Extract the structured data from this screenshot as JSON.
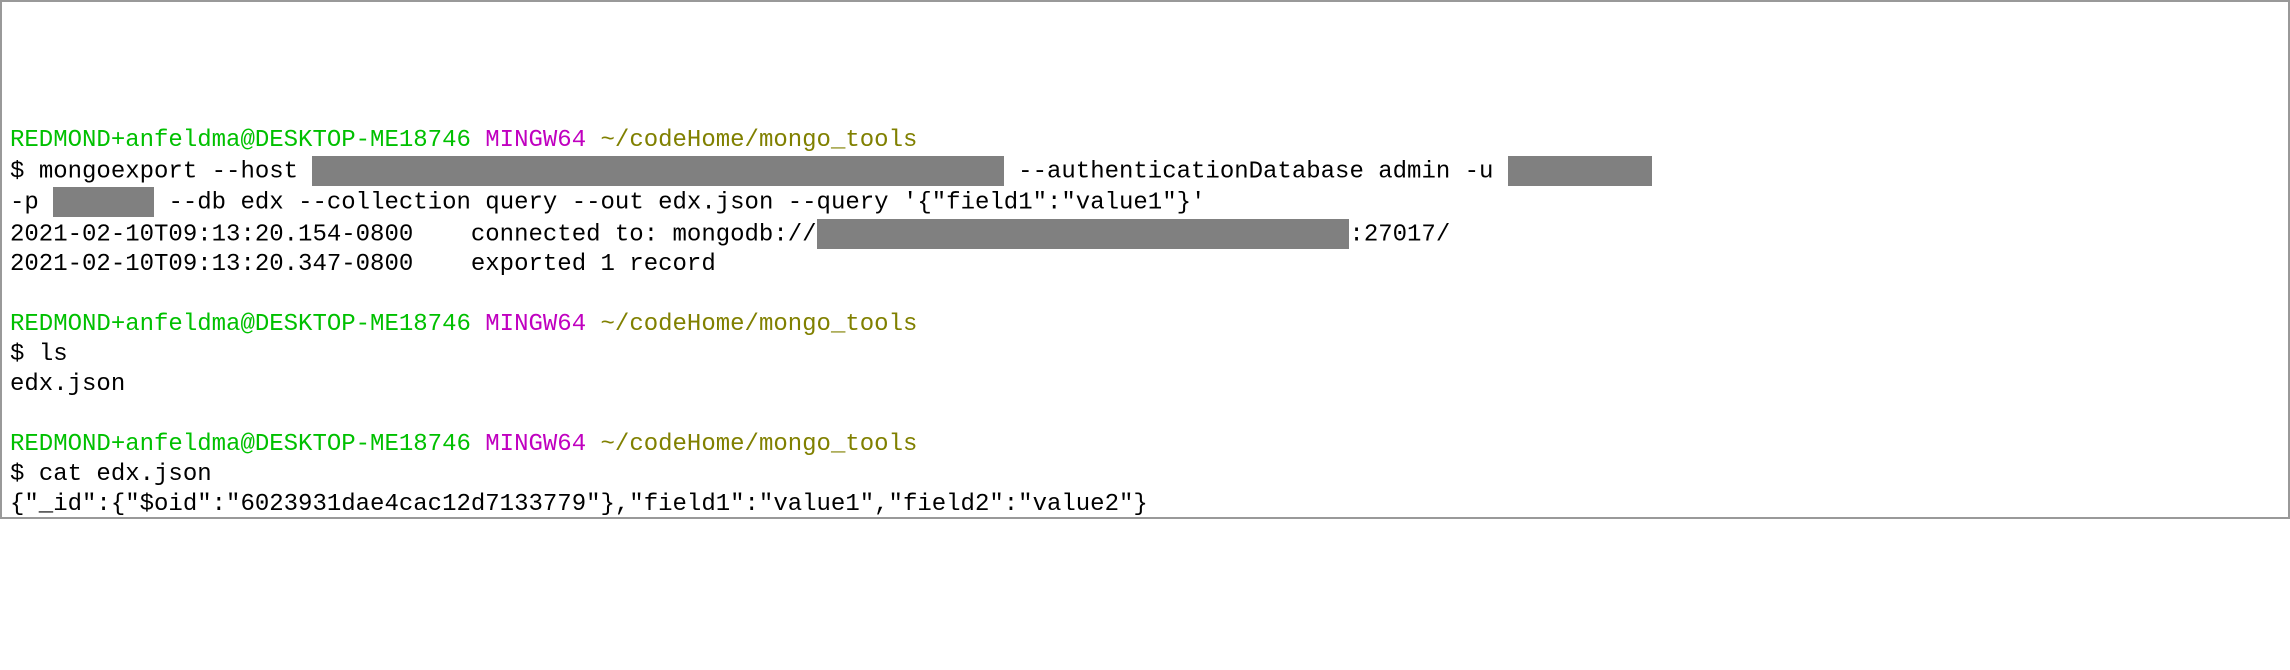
{
  "prompt": {
    "user": "REDMOND+anfeldma@DESKTOP-ME18746",
    "env": "MINGW64",
    "path": "~/codeHome/mongo_tools",
    "symbol": "$"
  },
  "block1": {
    "cmd_part1": "mongoexport --host ",
    "redacted1": "                                                ",
    "cmd_part2": " --authenticationDatabase admin -u ",
    "redacted2": "          ",
    "cmd_part3": "-p ",
    "redacted3": "       ",
    "cmd_part4": " --db edx --collection query --out edx.json --query '{\"field1\":\"value1\"}'",
    "out_line1_a": "2021-02-10T09:13:20.154-0800    connected to: mongodb://",
    "redacted4": "                                     ",
    "out_line1_b": ":27017/",
    "out_line2": "2021-02-10T09:13:20.347-0800    exported 1 record"
  },
  "block2": {
    "cmd": "ls",
    "out": "edx.json"
  },
  "block3": {
    "cmd": "cat edx.json",
    "out": "{\"_id\":{\"$oid\":\"6023931dae4cac12d7133779\"},\"field1\":\"value1\",\"field2\":\"value2\"}"
  }
}
